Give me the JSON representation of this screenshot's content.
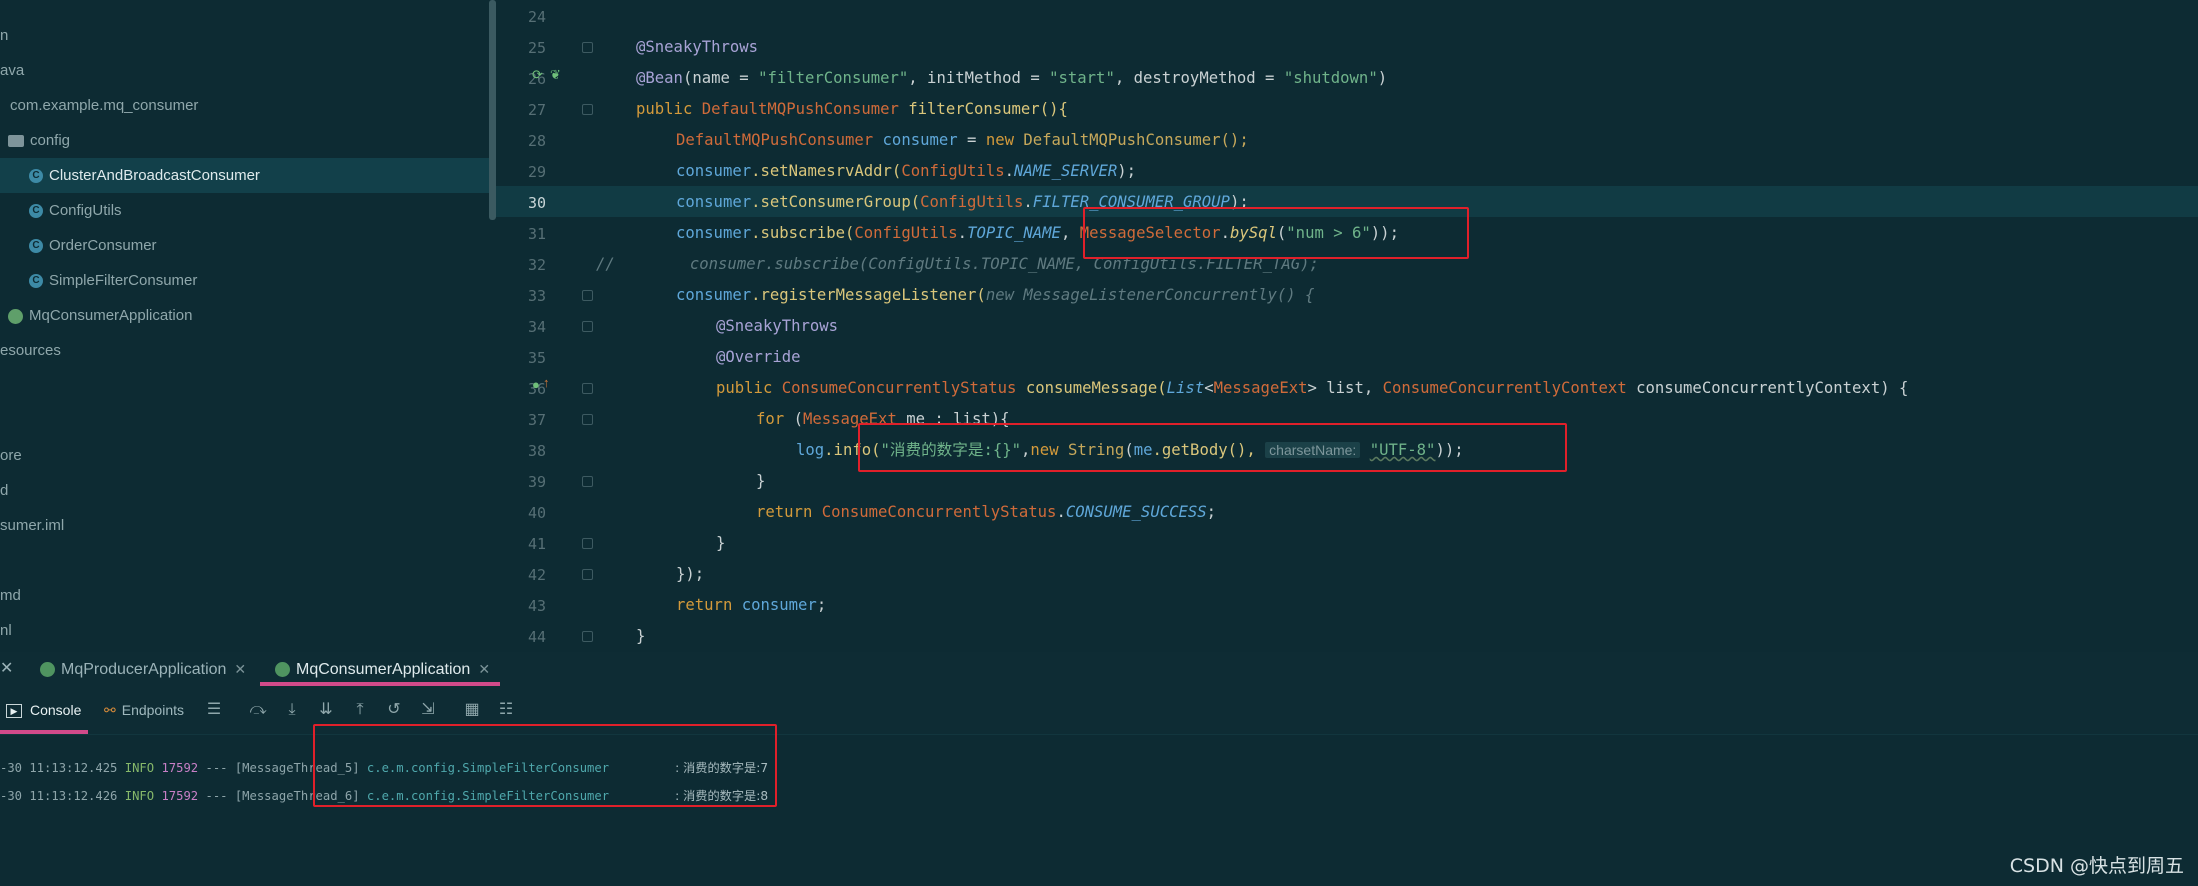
{
  "project_tree": {
    "items": [
      {
        "label": "n",
        "kind": "folder"
      },
      {
        "label": "ava",
        "kind": "folder"
      },
      {
        "label": "com.example.mq_consumer",
        "kind": "package"
      },
      {
        "label": "config",
        "kind": "package"
      },
      {
        "label": "ClusterAndBroadcastConsumer",
        "kind": "class",
        "selected": true
      },
      {
        "label": "ConfigUtils",
        "kind": "class"
      },
      {
        "label": "OrderConsumer",
        "kind": "class"
      },
      {
        "label": "SimpleFilterConsumer",
        "kind": "class"
      },
      {
        "label": "MqConsumerApplication",
        "kind": "app"
      },
      {
        "label": "esources",
        "kind": "folder"
      },
      {
        "label": "ore",
        "kind": "file"
      },
      {
        "label": "d",
        "kind": "file"
      },
      {
        "label": "sumer.iml",
        "kind": "file"
      },
      {
        "label": "md",
        "kind": "file"
      },
      {
        "label": "nl",
        "kind": "file"
      }
    ]
  },
  "editor": {
    "current_line": "30",
    "line_numbers": [
      "24",
      "25",
      "26",
      "27",
      "28",
      "29",
      "30",
      "31",
      "32",
      "33",
      "34",
      "35",
      "36",
      "37",
      "38",
      "39",
      "40",
      "41",
      "42",
      "43",
      "44"
    ],
    "code": {
      "l25_annotation": "@SneakyThrows",
      "l26_at": "@Bean",
      "l26_args_a": "(name = ",
      "l26_name": "\"filterConsumer\"",
      "l26_args_b": ", initMethod = ",
      "l26_init": "\"start\"",
      "l26_args_c": ", destroyMethod = ",
      "l26_destroy": "\"shutdown\"",
      "l26_args_d": ")",
      "l27_public": "public ",
      "l27_type": "DefaultMQPushConsumer",
      "l27_rest": " filterConsumer(){",
      "l28_type": "DefaultMQPushConsumer",
      "l28_var": " consumer",
      "l28_eq": " = ",
      "l28_new": "new ",
      "l28_ctor": "DefaultMQPushConsumer();",
      "l29_var": "consumer",
      "l29_call": ".setNamesrvAddr(",
      "l29_cls": "ConfigUtils",
      "l29_dot": ".",
      "l29_fld": "NAME_SERVER",
      "l29_end": ");",
      "l30_var": "consumer",
      "l30_call": ".setConsumerGroup(",
      "l30_cls": "ConfigUtils",
      "l30_dot": ".",
      "l30_fld": "FILTER_CONSUMER_GROUP",
      "l30_end": ");",
      "l31_var": "consumer",
      "l31_call": ".subscribe(",
      "l31_cls": "ConfigUtils",
      "l31_dot": ".",
      "l31_fld": "TOPIC_NAME",
      "l31_comma": ", ",
      "l31_sel": "MessageSelector",
      "l31_dot2": ".",
      "l31_bysql": "bySql",
      "l31_open": "(",
      "l31_str": "\"num > 6\"",
      "l31_end": "));",
      "l32_comment": "//        consumer.subscribe(ConfigUtils.TOPIC_NAME, ConfigUtils.FILTER_TAG);",
      "l33_var": "consumer",
      "l33_call": ".registerMessageListener(",
      "l33_new": "new MessageListenerConcurrently() {",
      "l34_annotation": "@SneakyThrows",
      "l35_annotation": "@Override",
      "l36_public": "public ",
      "l36_type": "ConsumeConcurrentlyStatus",
      "l36_method": " consumeMessage(",
      "l36_list": "List",
      "l36_lt": "<",
      "l36_me": "MessageExt",
      "l36_gt": "> list, ",
      "l36_ctx": "ConsumeConcurrentlyContext",
      "l36_end": " consumeConcurrentlyContext) {",
      "l37_for": "for ",
      "l37_open": "(",
      "l37_type": "MessageExt",
      "l37_rest": " me : list){",
      "l38_log": "log",
      "l38_info": ".info(",
      "l38_str": "\"消费的数字是:{}\"",
      "l38_comma": ",",
      "l38_new": "new ",
      "l38_string": "String",
      "l38_open": "(",
      "l38_me": "me",
      "l38_getbody": ".getBody(), ",
      "l38_hint": "charsetName:",
      "l38_utf": "\"UTF-8\"",
      "l38_end": "));",
      "l39": "}",
      "l40_return": "return ",
      "l40_type": "ConsumeConcurrentlyStatus",
      "l40_dot": ".",
      "l40_fld": "CONSUME_SUCCESS",
      "l40_end": ";",
      "l41": "}",
      "l42": "});",
      "l43_return": "return ",
      "l43_var": "consumer",
      "l43_end": ";",
      "l44": "}"
    }
  },
  "run_tabs": [
    {
      "label": "MqProducerApplication",
      "active": false
    },
    {
      "label": "MqConsumerApplication",
      "active": true
    }
  ],
  "console_toolbar": {
    "console_label": "Console",
    "endpoints_label": "Endpoints"
  },
  "console": {
    "lines": [
      {
        "time": "-30 11:13:12.425",
        "level": "INFO",
        "pid": "17592",
        "sep": " --- ",
        "thread": "[MessageThread_5]",
        "logger": "c.e.m.config.SimpleFilterConsumer",
        "msg": ": 消费的数字是:7"
      },
      {
        "time": "-30 11:13:12.426",
        "level": "INFO",
        "pid": "17592",
        "sep": " --- ",
        "thread": "[MessageThread_6]",
        "logger": "c.e.m.config.SimpleFilterConsumer",
        "msg": ": 消费的数字是:8"
      }
    ]
  },
  "watermark": "CSDN @快点到周五",
  "colors": {
    "highlight_box": "#e0202a",
    "tab_underline": "#d24a8a",
    "background": "#0d2b33"
  }
}
